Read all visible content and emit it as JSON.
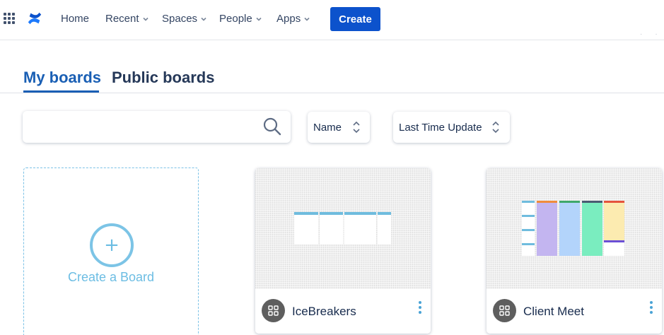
{
  "nav": {
    "items": [
      {
        "label": "Home",
        "has_menu": false
      },
      {
        "label": "Recent",
        "has_menu": true
      },
      {
        "label": "Spaces",
        "has_menu": true
      },
      {
        "label": "People",
        "has_menu": true
      },
      {
        "label": "Apps",
        "has_menu": true
      }
    ],
    "create_label": "Create",
    "brand_color": "#0c52cc"
  },
  "tabs": [
    {
      "label": "My boards",
      "active": true
    },
    {
      "label": "Public boards",
      "active": false
    }
  ],
  "filters": {
    "search_value": "",
    "sort_by": "Name",
    "sort_time": "Last Time Update"
  },
  "new_board": {
    "label": "Create a Board"
  },
  "boards": [
    {
      "name": "IceBreakers",
      "icon": "grid-icon"
    },
    {
      "name": "Client Meet",
      "icon": "grid-icon"
    }
  ],
  "colors": {
    "accent": "#1a5fb4",
    "thumb_column_purple": "#c3b5f0",
    "thumb_column_blue": "#b3d4fb",
    "thumb_column_green": "#7aedbf",
    "thumb_column_yellow": "#fcebb0"
  }
}
